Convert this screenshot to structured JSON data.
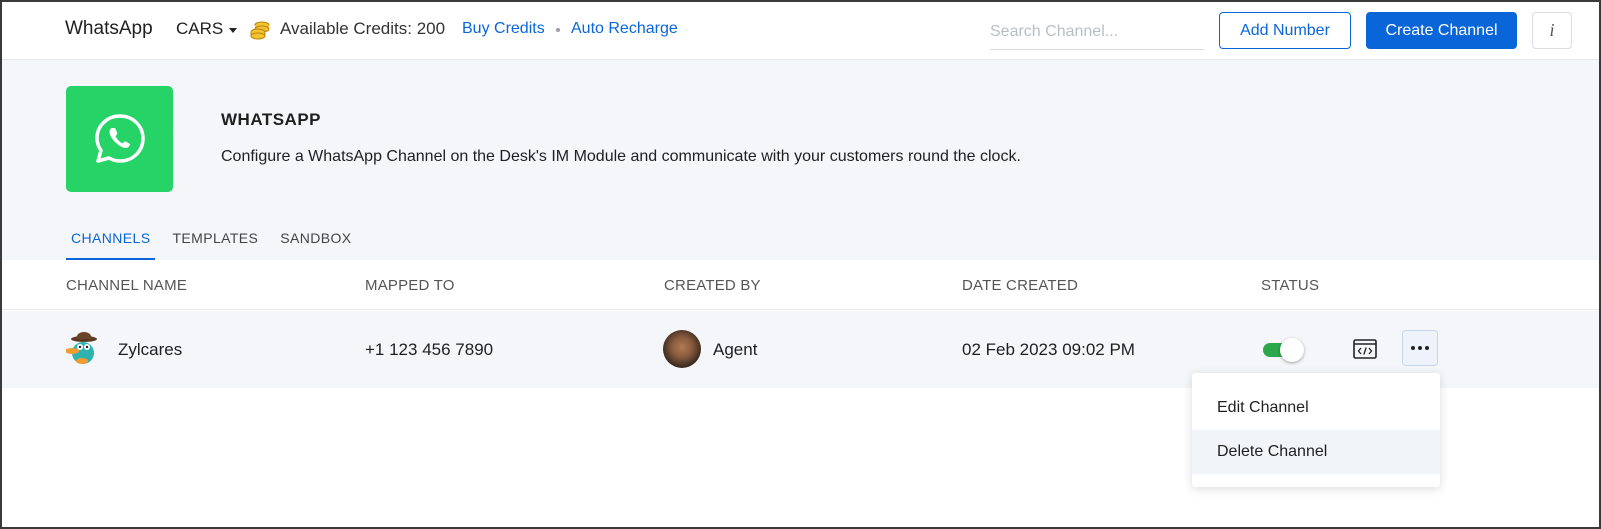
{
  "header": {
    "app_title": "WhatsApp",
    "org_name": "CARS",
    "credits_text": "Available Credits: 200",
    "buy_credits": "Buy Credits",
    "auto_recharge": "Auto Recharge",
    "search_placeholder": "Search Channel...",
    "add_number": "Add Number",
    "create_channel": "Create Channel",
    "info": "i",
    "accent_color": "#0a66d8"
  },
  "intro": {
    "heading": "WHATSAPP",
    "description": "Configure a WhatsApp Channel on the Desk's IM Module and communicate with your customers round the clock.",
    "logo_color": "#25d366"
  },
  "tabs": [
    {
      "label": "CHANNELS",
      "active": true
    },
    {
      "label": "TEMPLATES",
      "active": false
    },
    {
      "label": "SANDBOX",
      "active": false
    }
  ],
  "table": {
    "columns": [
      "CHANNEL NAME",
      "MAPPED TO",
      "CREATED BY",
      "DATE CREATED",
      "STATUS"
    ],
    "rows": [
      {
        "channel_name": "Zylcares",
        "mapped_to": "+1 123 456 7890",
        "created_by": "Agent",
        "date_created": "02 Feb 2023 09:02 PM",
        "status_enabled": true
      }
    ]
  },
  "row_menu": {
    "items": [
      "Edit Channel",
      "Delete Channel"
    ]
  }
}
